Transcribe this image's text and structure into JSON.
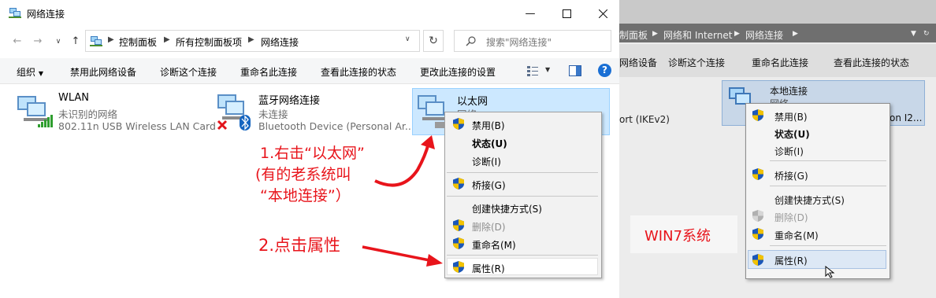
{
  "win10": {
    "title": "网络连接",
    "address": {
      "crumbs": [
        "控制面板",
        "所有控制面板项",
        "网络连接"
      ],
      "search_placeholder": "搜索\"网络连接\""
    },
    "toolbar": {
      "organize": "组织",
      "disable_device": "禁用此网络设备",
      "diagnose": "诊断这个连接",
      "rename": "重命名此连接",
      "view_status": "查看此连接的状态",
      "change_settings": "更改此连接的设置",
      "help": "?"
    },
    "items": [
      {
        "name": "WLAN",
        "status": "未识别的网络",
        "device": "802.11n USB Wireless LAN Card"
      },
      {
        "name": "蓝牙网络连接",
        "status": "未连接",
        "device": "Bluetooth Device (Personal Ar..."
      },
      {
        "name": "以太网",
        "status": "网络"
      }
    ],
    "context_menu": {
      "disable": "禁用(B)",
      "status": "状态(U)",
      "diagnose": "诊断(I)",
      "bridge": "桥接(G)",
      "shortcut": "创建快捷方式(S)",
      "delete": "删除(D)",
      "rename": "重命名(M)",
      "properties": "属性(R)"
    },
    "annotations": {
      "step1_line1": "1.右击“以太网”",
      "step1_line2": "(有的老系统叫",
      "step1_line3": "“本地连接”）",
      "step2": "2.点击属性"
    }
  },
  "win7": {
    "crumbs": [
      "制面板",
      "网络和 Internet",
      "网络连接"
    ],
    "toolbar": [
      "网络设备",
      "诊断这个连接",
      "重命名此连接",
      "查看此连接的状态"
    ],
    "selected_item": {
      "name": "本地连接",
      "status": "网络"
    },
    "left_partial": "ort (IKEv2)",
    "right_partial": "on I2...",
    "context_menu": {
      "disable": "禁用(B)",
      "status": "状态(U)",
      "diagnose": "诊断(I)",
      "bridge": "桥接(G)",
      "shortcut": "创建快捷方式(S)",
      "delete": "删除(D)",
      "rename": "重命名(M)",
      "properties": "属性(R)"
    },
    "label": "WIN7系统"
  },
  "colors": {
    "annotation": "#e8141b",
    "selection": "#cce8ff",
    "help_blue": "#1a6fd4"
  }
}
